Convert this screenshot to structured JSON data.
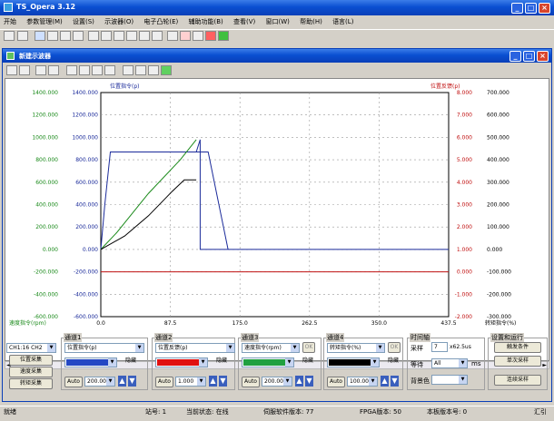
{
  "app": {
    "title": "TS_Opera 3.12",
    "icon": "app-icon"
  },
  "menu": [
    "开始",
    "参数管理(M)",
    "设置(S)",
    "示波器(O)",
    "电子凸轮(E)",
    "辅助功能(B)",
    "查看(V)",
    "窗口(W)",
    "帮助(H)",
    "语言(L)"
  ],
  "subwin": {
    "title": "新建示波器"
  },
  "chart_data": {
    "type": "line",
    "y1": {
      "title": "",
      "ticks": [
        "1400.000",
        "1200.000",
        "1000.000",
        "800.000",
        "600.000",
        "400.000",
        "200.000",
        "0.000",
        "-200.000",
        "-400.000",
        "-600.000"
      ],
      "range": [
        -600,
        1400
      ],
      "color": "#1a8a1a",
      "bottom_label": "速度指令(rpm)"
    },
    "y2": {
      "title": "位置指令(p)",
      "ticks": [
        "1400.000",
        "1200.000",
        "1000.000",
        "800.000",
        "600.000",
        "400.000",
        "200.000",
        "0.000",
        "-200.000",
        "-400.000",
        "-600.000"
      ],
      "range": [
        -600,
        1400
      ],
      "color": "#1a2a9a"
    },
    "y3": {
      "title": "位置反馈(p)",
      "ticks": [
        "8.000",
        "7.000",
        "6.000",
        "5.000",
        "4.000",
        "3.000",
        "2.000",
        "1.000",
        "0.000",
        "-1.000",
        "-2.000"
      ],
      "range": [
        -2,
        8
      ],
      "color": "#c01010"
    },
    "y4": {
      "title": "转矩指令(%)",
      "ticks": [
        "700.000",
        "600.000",
        "500.000",
        "400.000",
        "300.000",
        "200.000",
        "100.000",
        "0.000",
        "-100.000",
        "-200.000",
        "-300.000"
      ],
      "range": [
        -300,
        700
      ]
    },
    "x": {
      "ticks": [
        "0.0",
        "87.5",
        "175.0",
        "262.5",
        "350.0",
        "437.5"
      ],
      "range": [
        0,
        437.5
      ]
    },
    "series": [
      {
        "color": "#1a2a9a",
        "points": [
          [
            0,
            0
          ],
          [
            5,
            400
          ],
          [
            12,
            870
          ],
          [
            120,
            870
          ],
          [
            125,
            980
          ],
          [
            125,
            0
          ],
          [
            437.5,
            0
          ]
        ]
      },
      {
        "color": "#1a2a9a",
        "points": [
          [
            120,
            870
          ],
          [
            135,
            870
          ],
          [
            160,
            0
          ]
        ]
      },
      {
        "color": "#1a8a1a",
        "points": [
          [
            0,
            0
          ],
          [
            20,
            150
          ],
          [
            60,
            500
          ],
          [
            100,
            800
          ],
          [
            120,
            980
          ]
        ]
      },
      {
        "color": "#000000",
        "points": [
          [
            0,
            0
          ],
          [
            30,
            120
          ],
          [
            60,
            300
          ],
          [
            90,
            520
          ],
          [
            105,
            620
          ],
          [
            120,
            620
          ]
        ]
      },
      {
        "color": "#c01010",
        "points": [
          [
            0,
            -200
          ],
          [
            437.5,
            -200
          ]
        ]
      }
    ]
  },
  "channels": [
    {
      "label": "通道1",
      "signal": "位置指令(p)",
      "color": "#2448c4",
      "hide": "隐藏",
      "auto": "Auto",
      "scale": "200.00"
    },
    {
      "label": "通道2",
      "signal": "位置反馈(p)",
      "color": "#e01010",
      "hide": "隐藏",
      "auto": "Auto",
      "scale": "1.000"
    },
    {
      "label": "通道3",
      "signal": "速度指令(rpm)",
      "color": "#20a040",
      "hide": "隐藏",
      "auto": "Auto",
      "scale": "200.00",
      "offset": "OK"
    },
    {
      "label": "通道4",
      "signal": "转矩指令(%)",
      "color": "#000000",
      "hide": "隐藏",
      "auto": "Auto",
      "scale": "100.00",
      "offset": "OK"
    }
  ],
  "left_panel": {
    "select": "CH1:16 CH2",
    "buttons": [
      "位置采集",
      "速度采集",
      "转矩采集"
    ]
  },
  "time": {
    "label": "时间轴",
    "sample_label": "采样",
    "sample_value": "7",
    "sample_unit": "x62.5us",
    "wait_label": "等待",
    "wait_value": "All",
    "wait_unit": "ms",
    "bg_label": "背景色"
  },
  "run": {
    "label": "设置和运行",
    "buttons": [
      "触发条件",
      "单次采样",
      "连续采样"
    ]
  },
  "status": {
    "ready": "就绪",
    "station": "站号: 1",
    "state": "当前状态: 在线",
    "servo": "伺服软件版本: 77",
    "fpga": "FPGA版本: 50",
    "hw": "本板版本号: 0",
    "extra": "汇引"
  }
}
